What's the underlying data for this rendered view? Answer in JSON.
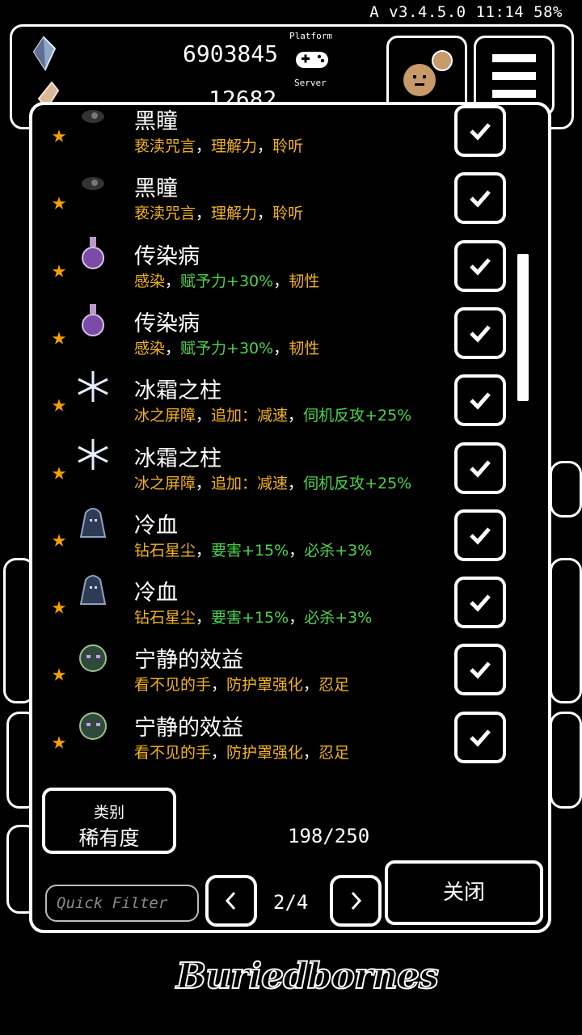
{
  "status_bar": {
    "text": "A v3.4.5.0 11:14 58%"
  },
  "hud": {
    "currency_primary": "6903845",
    "currency_secondary": "12682",
    "platform_label": "Platform",
    "server_label": "Server"
  },
  "items": [
    {
      "name": "黑瞳",
      "icon": "dark-eye-icon",
      "desc": [
        {
          "t": "亵渎咒言",
          "c": "y"
        },
        {
          "t": "，",
          "c": "w"
        },
        {
          "t": "理解力",
          "c": "y"
        },
        {
          "t": "，",
          "c": "w"
        },
        {
          "t": "聆听",
          "c": "y"
        }
      ]
    },
    {
      "name": "黑瞳",
      "icon": "dark-eye-icon",
      "desc": [
        {
          "t": "亵渎咒言",
          "c": "y"
        },
        {
          "t": "，",
          "c": "w"
        },
        {
          "t": "理解力",
          "c": "y"
        },
        {
          "t": "，",
          "c": "w"
        },
        {
          "t": "聆听",
          "c": "y"
        }
      ]
    },
    {
      "name": "传染病",
      "icon": "potion-icon",
      "desc": [
        {
          "t": "感染",
          "c": "y"
        },
        {
          "t": "，",
          "c": "w"
        },
        {
          "t": "赋予力+30%",
          "c": "g"
        },
        {
          "t": "，",
          "c": "w"
        },
        {
          "t": "韧性",
          "c": "y"
        }
      ]
    },
    {
      "name": "传染病",
      "icon": "potion-icon",
      "desc": [
        {
          "t": "感染",
          "c": "y"
        },
        {
          "t": "，",
          "c": "w"
        },
        {
          "t": "赋予力+30%",
          "c": "g"
        },
        {
          "t": "，",
          "c": "w"
        },
        {
          "t": "韧性",
          "c": "y"
        }
      ]
    },
    {
      "name": "冰霜之柱",
      "icon": "snowflake-icon",
      "desc": [
        {
          "t": "冰之屏障",
          "c": "y"
        },
        {
          "t": "，",
          "c": "w"
        },
        {
          "t": "追加：减速",
          "c": "y"
        },
        {
          "t": "，",
          "c": "w"
        },
        {
          "t": "伺机反攻+25%",
          "c": "g"
        }
      ]
    },
    {
      "name": "冰霜之柱",
      "icon": "snowflake-icon",
      "desc": [
        {
          "t": "冰之屏障",
          "c": "y"
        },
        {
          "t": "，",
          "c": "w"
        },
        {
          "t": "追加：减速",
          "c": "y"
        },
        {
          "t": "，",
          "c": "w"
        },
        {
          "t": "伺机反攻+25%",
          "c": "g"
        }
      ]
    },
    {
      "name": "冷血",
      "icon": "hooded-figure-icon",
      "desc": [
        {
          "t": "钻石星尘",
          "c": "y"
        },
        {
          "t": "，",
          "c": "w"
        },
        {
          "t": "要害+15%",
          "c": "g"
        },
        {
          "t": "，",
          "c": "w"
        },
        {
          "t": "必杀+3%",
          "c": "g"
        }
      ]
    },
    {
      "name": "冷血",
      "icon": "hooded-figure-icon",
      "desc": [
        {
          "t": "钻石星尘",
          "c": "y"
        },
        {
          "t": "，",
          "c": "w"
        },
        {
          "t": "要害+15%",
          "c": "g"
        },
        {
          "t": "，",
          "c": "w"
        },
        {
          "t": "必杀+3%",
          "c": "g"
        }
      ]
    },
    {
      "name": "宁静的效益",
      "icon": "calm-spirit-icon",
      "desc": [
        {
          "t": "看不见的手",
          "c": "y"
        },
        {
          "t": "，",
          "c": "w"
        },
        {
          "t": "防护罩强化",
          "c": "y"
        },
        {
          "t": "，",
          "c": "w"
        },
        {
          "t": "忍足",
          "c": "y"
        }
      ]
    },
    {
      "name": "宁静的效益",
      "icon": "calm-spirit-icon",
      "desc": [
        {
          "t": "看不见的手",
          "c": "y"
        },
        {
          "t": "，",
          "c": "w"
        },
        {
          "t": "防护罩强化",
          "c": "y"
        },
        {
          "t": "，",
          "c": "w"
        },
        {
          "t": "忍足",
          "c": "y"
        }
      ]
    }
  ],
  "controls": {
    "category_label": "类别",
    "category_value": "稀有度",
    "count": "198/250",
    "filter_placeholder": "Quick Filter",
    "page": "2/4",
    "close_label": "关闭"
  },
  "logo": "Buriedbornes",
  "colors": {
    "star": "#f5a000",
    "yellow_text": "#f2b31c",
    "green_text": "#4bd44b",
    "background": "#000000",
    "border": "#ffffff"
  }
}
